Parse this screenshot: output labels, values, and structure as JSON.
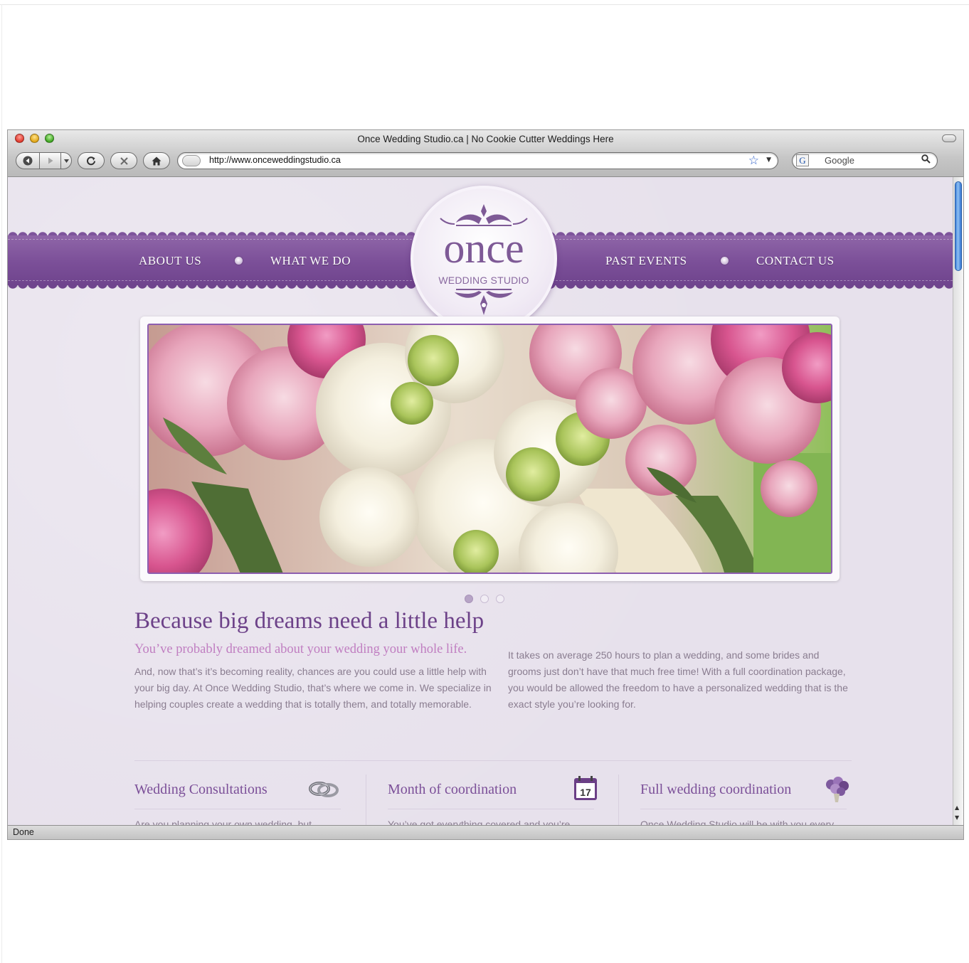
{
  "browser": {
    "window_title": "Once Wedding Studio.ca | No Cookie Cutter Weddings Here",
    "url": "http://www.onceweddingstudio.ca",
    "search_placeholder": "Google",
    "search_engine_glyph": "G",
    "status": "Done"
  },
  "site": {
    "nav_left": [
      "ABOUT US",
      "WHAT WE DO"
    ],
    "nav_right": [
      "PAST EVENTS",
      "CONTACT US"
    ],
    "logo": {
      "word": "once",
      "sub": "WEDDING STUDIO"
    },
    "slider": {
      "count": 3,
      "active": 0
    },
    "headline": "Because big dreams need a little help",
    "subheadline": "You’ve probably dreamed about your wedding your whole life.",
    "para_left": "And, now that’s it’s becoming reality, chances are you could use a little help with your big day. At Once Wedding Studio, that’s where we come in. We specialize in helping couples create a wedding that is totally them, and totally memorable.",
    "para_right": "It takes on average 250 hours to plan a wedding, and some brides and grooms just don’t have that much free time! With a full coordination package, you would be allowed the freedom to have a personalized wedding that is the exact style you’re looking for.",
    "features": [
      {
        "title": "Wedding Consultations",
        "icon": "rings-icon",
        "text": "Are you planning your own wedding, but"
      },
      {
        "title": "Month of coordination",
        "icon": "calendar-icon",
        "calendar_day": "17",
        "text": "You’ve got everything covered and you’re"
      },
      {
        "title": "Full wedding coordination",
        "icon": "bouquet-icon",
        "text": "Once Wedding Studio will be with you every"
      }
    ]
  },
  "colors": {
    "brand_purple": "#7b4f98",
    "headline": "#6d4289",
    "subhead_pink": "#c07ec1",
    "body_text": "#8a7d90",
    "page_bg": "#e7e1ec"
  }
}
